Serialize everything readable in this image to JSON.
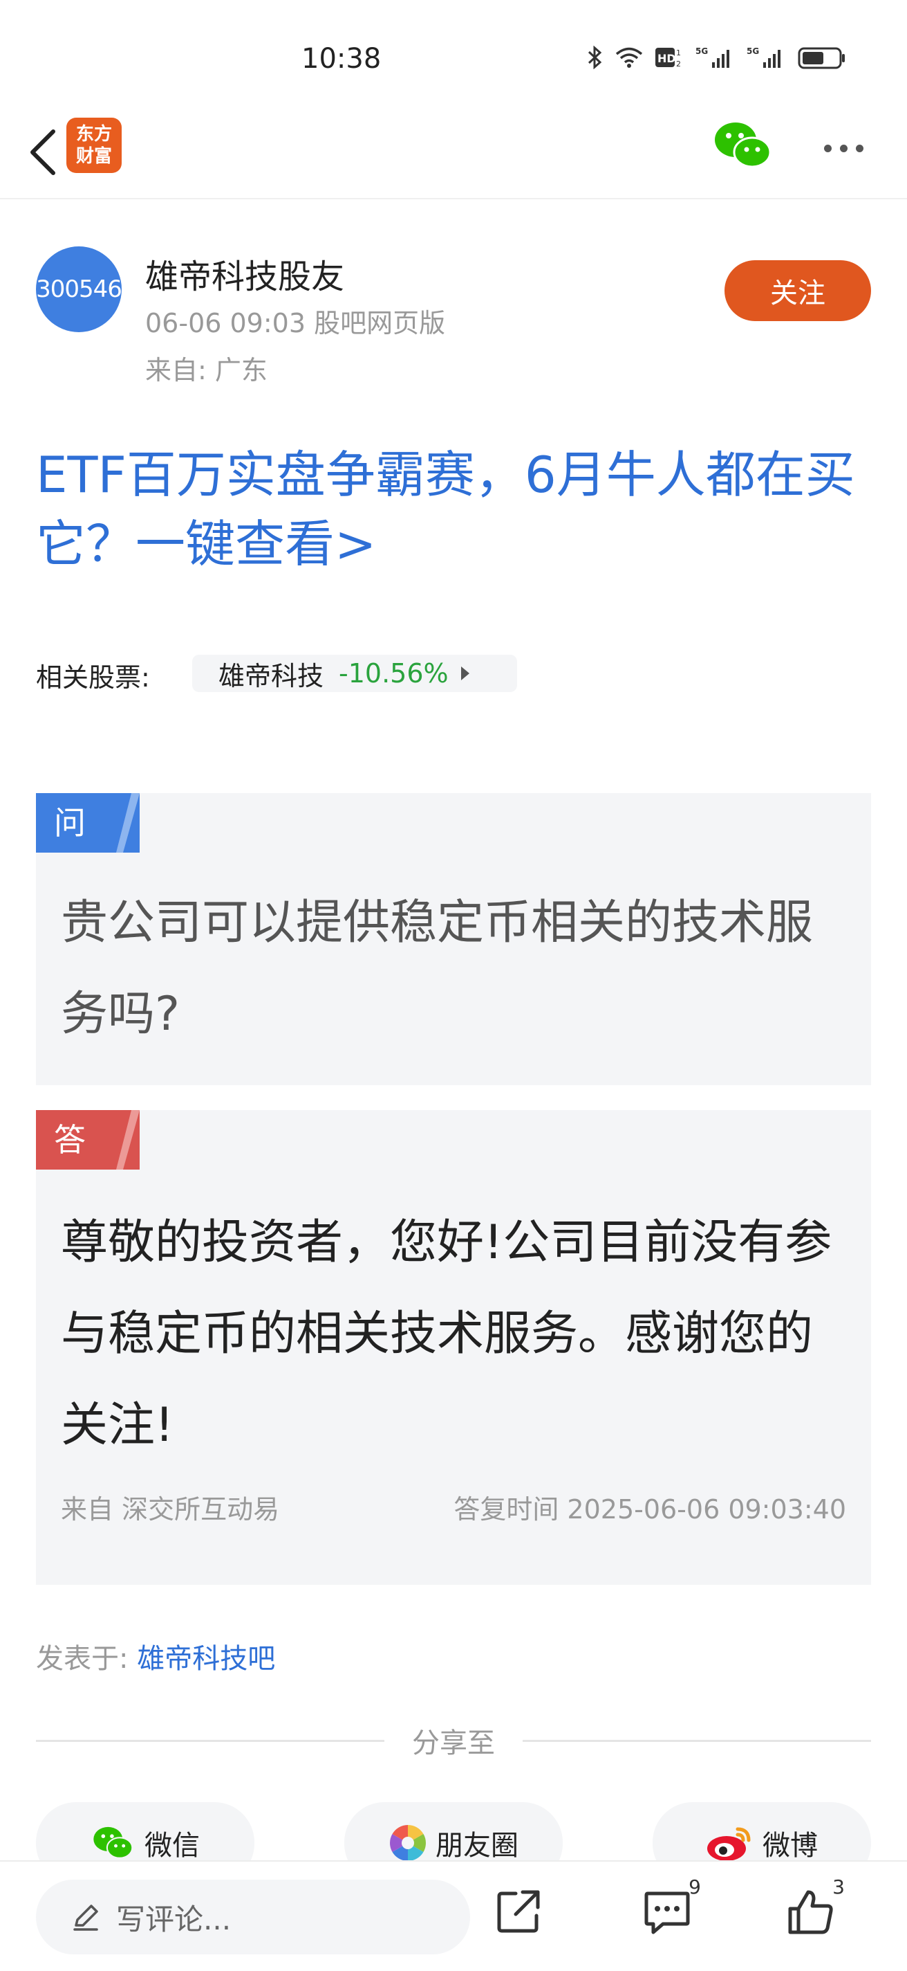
{
  "status_bar": {
    "time": "10:38"
  },
  "nav": {
    "logo_line1": "东方",
    "logo_line2": "财富"
  },
  "author": {
    "avatar_code": "300546",
    "name": "雄帝科技股友",
    "meta": "06-06 09:03 股吧网页版",
    "from": "来自: 广东",
    "follow_label": "关注"
  },
  "promo": {
    "text": "ETF百万实盘争霸赛，6月牛人都在买它？一键查看>"
  },
  "related": {
    "label": "相关股票:",
    "stock_name": "雄帝科技",
    "stock_change": "-10.56%"
  },
  "question": {
    "tag": "问",
    "text": "贵公司可以提供稳定币相关的技术服务吗?"
  },
  "answer": {
    "tag": "答",
    "text": "尊敬的投资者，您好!公司目前没有参与稳定币的相关技术服务。感谢您的关注!",
    "source": "来自 深交所互动易",
    "time": "答复时间 2025-06-06 09:03:40"
  },
  "posted_in": {
    "prefix": "发表于:",
    "bar_name": "雄帝科技吧"
  },
  "share": {
    "label": "分享至",
    "wechat": "微信",
    "moments": "朋友圈",
    "weibo": "微博"
  },
  "bottom_bar": {
    "comment_placeholder": "写评论...",
    "comment_count": "9",
    "like_count": "3"
  },
  "colors": {
    "brand_orange": "#e0571f",
    "link_blue": "#2e6fd6",
    "down_green": "#2aa33d",
    "question_blue": "#3f7fe0",
    "answer_red": "#d9534f"
  }
}
